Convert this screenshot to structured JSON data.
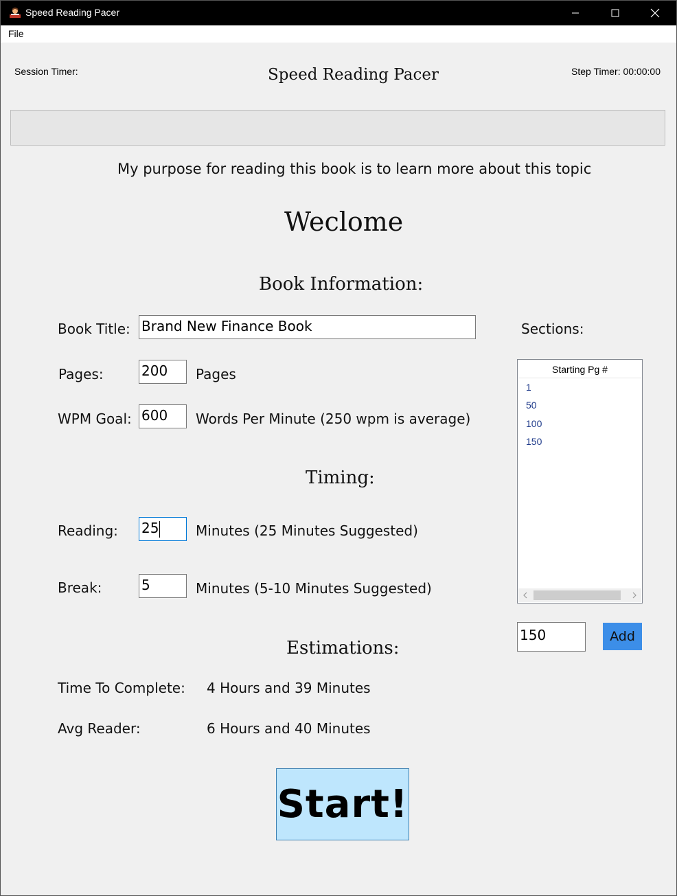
{
  "window": {
    "title": "Speed Reading Pacer"
  },
  "menu": {
    "file": "File"
  },
  "header": {
    "session_timer": "Session Timer:",
    "title": "Speed Reading Pacer",
    "step_timer": "Step Timer: 00:00:00"
  },
  "progress": {
    "value": 0
  },
  "purpose": "My purpose for reading this book is to learn more about this topic",
  "welcome": "Weclome",
  "book_info": {
    "heading": "Book Information:",
    "title_label": "Book Title:",
    "title_value": "Brand New Finance Book",
    "pages_label": "Pages:",
    "pages_value": "200",
    "pages_unit": "Pages",
    "wpm_label": "WPM Goal:",
    "wpm_value": "600",
    "wpm_unit": "Words Per Minute (250 wpm is average)"
  },
  "timing": {
    "heading": "Timing:",
    "reading_label": "Reading:",
    "reading_value": "25",
    "reading_unit": "Minutes (25 Minutes Suggested)",
    "break_label": "Break:",
    "break_value": "5",
    "break_unit": "Minutes (5-10 Minutes Suggested)"
  },
  "estimations": {
    "heading": "Estimations:",
    "complete_label": "Time To Complete:",
    "complete_value": "4 Hours and 39 Minutes",
    "avg_label": "Avg Reader:",
    "avg_value": "6 Hours and 40 Minutes"
  },
  "sections": {
    "label": "Sections:",
    "column_header": "Starting Pg #",
    "items": [
      "1",
      "50",
      "100",
      "150"
    ],
    "input_value": "150",
    "add_label": "Add"
  },
  "start_label": "Start!",
  "colors": {
    "title_bar": "#000000",
    "add_button": "#3c8ee8",
    "start_button": "#bee6fd",
    "list_text": "#1e3a8a"
  }
}
